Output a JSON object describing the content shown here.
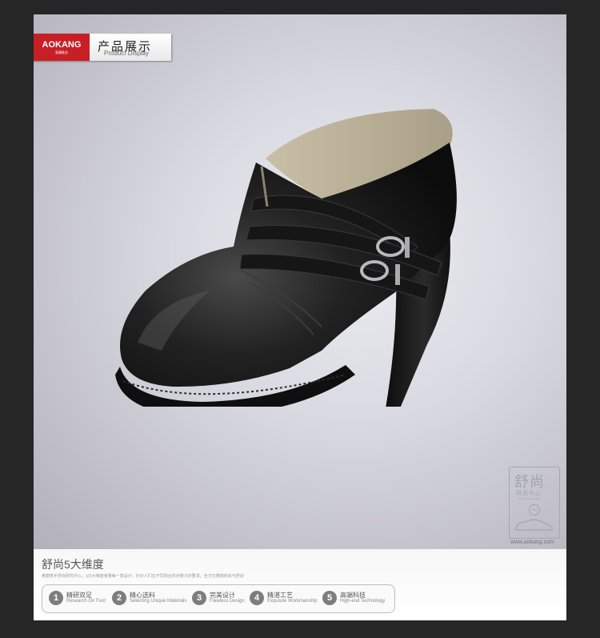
{
  "brand": {
    "logo_text": "AOKANG",
    "logo_sub": "奥康鞋业",
    "badge_title": "产品展示",
    "badge_subtitle": "Product Display"
  },
  "stamp": {
    "title": "舒尚",
    "subtitle": "研究中心",
    "tiny_text": "comfort fashion center",
    "circle_text": "CRC",
    "website": "www.aokang.com"
  },
  "dimensions": {
    "title": "舒尚5大维度",
    "description": "奥康携手舒尚研究中心，从5大维度考量每一款设计，针对人们在不同场合的对鞋子的要求，全方位赛窝时尚与舒适",
    "items": [
      {
        "num": "1",
        "cn": "精研双足",
        "en": "Research On Foot"
      },
      {
        "num": "2",
        "cn": "精心选料",
        "en": "Selecting Unique Materials"
      },
      {
        "num": "3",
        "cn": "完美设计",
        "en": "Flawless Design"
      },
      {
        "num": "4",
        "cn": "精湛工艺",
        "en": "Exquisite Workmanship"
      },
      {
        "num": "5",
        "cn": "高端科技",
        "en": "High-end Technology"
      }
    ]
  },
  "colors": {
    "brand_red": "#c81f26",
    "page_bg": "#262626",
    "shoe_leather": "#1b1b1b"
  }
}
